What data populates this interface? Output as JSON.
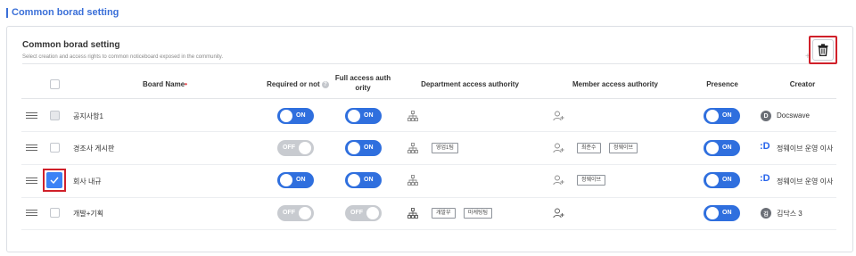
{
  "page": {
    "heading": "Common borad setting"
  },
  "card": {
    "title": "Common borad setting",
    "subtitle": "Select creation and access rights to common noticeboard exposed in the community."
  },
  "columns": {
    "board_name": "Board Name",
    "required_or_not": "Required or not",
    "full_access_line1": "Full access auth",
    "full_access_line2": "ority",
    "department_access": "Department access authority",
    "member_access": "Member access authority",
    "presence": "Presence",
    "creator": "Creator"
  },
  "toggle_labels": {
    "on": "ON",
    "off": "OFF"
  },
  "rows": [
    {
      "name": "공지사항1",
      "checked": false,
      "required": "ON",
      "full_access": "ON",
      "departments": [],
      "members": [],
      "presence": "ON",
      "creator": {
        "avatar": "D",
        "name": "Docswave"
      }
    },
    {
      "name": "경조사 게시판",
      "checked": false,
      "required": "OFF",
      "full_access": "ON",
      "departments": [
        "영업1팀"
      ],
      "members": [
        "최준수",
        "정웨이브"
      ],
      "presence": "ON",
      "creator": {
        "avatar": ":D",
        "name": "정웨이브 운영 이사"
      }
    },
    {
      "name": "회사 내규",
      "checked": true,
      "required": "ON",
      "full_access": "ON",
      "departments": [],
      "members": [
        "정웨이브"
      ],
      "presence": "ON",
      "creator": {
        "avatar": ":D",
        "name": "정웨이브 운영 이사"
      }
    },
    {
      "name": "개발+기획",
      "checked": false,
      "required": "OFF",
      "full_access": "OFF",
      "departments": [
        "개발부",
        "마케팅팀"
      ],
      "members": [],
      "presence": "ON",
      "creator": {
        "avatar": "김",
        "name": "김닥스 3"
      }
    }
  ],
  "colors": {
    "accent": "#2f6fde",
    "highlight": "#d0202a",
    "required_dot": "#e0262e"
  },
  "icons": [
    "trash-icon",
    "help-circle-icon",
    "org-chart-icon",
    "add-user-icon",
    "drag-handle-icon",
    "check-icon"
  ]
}
